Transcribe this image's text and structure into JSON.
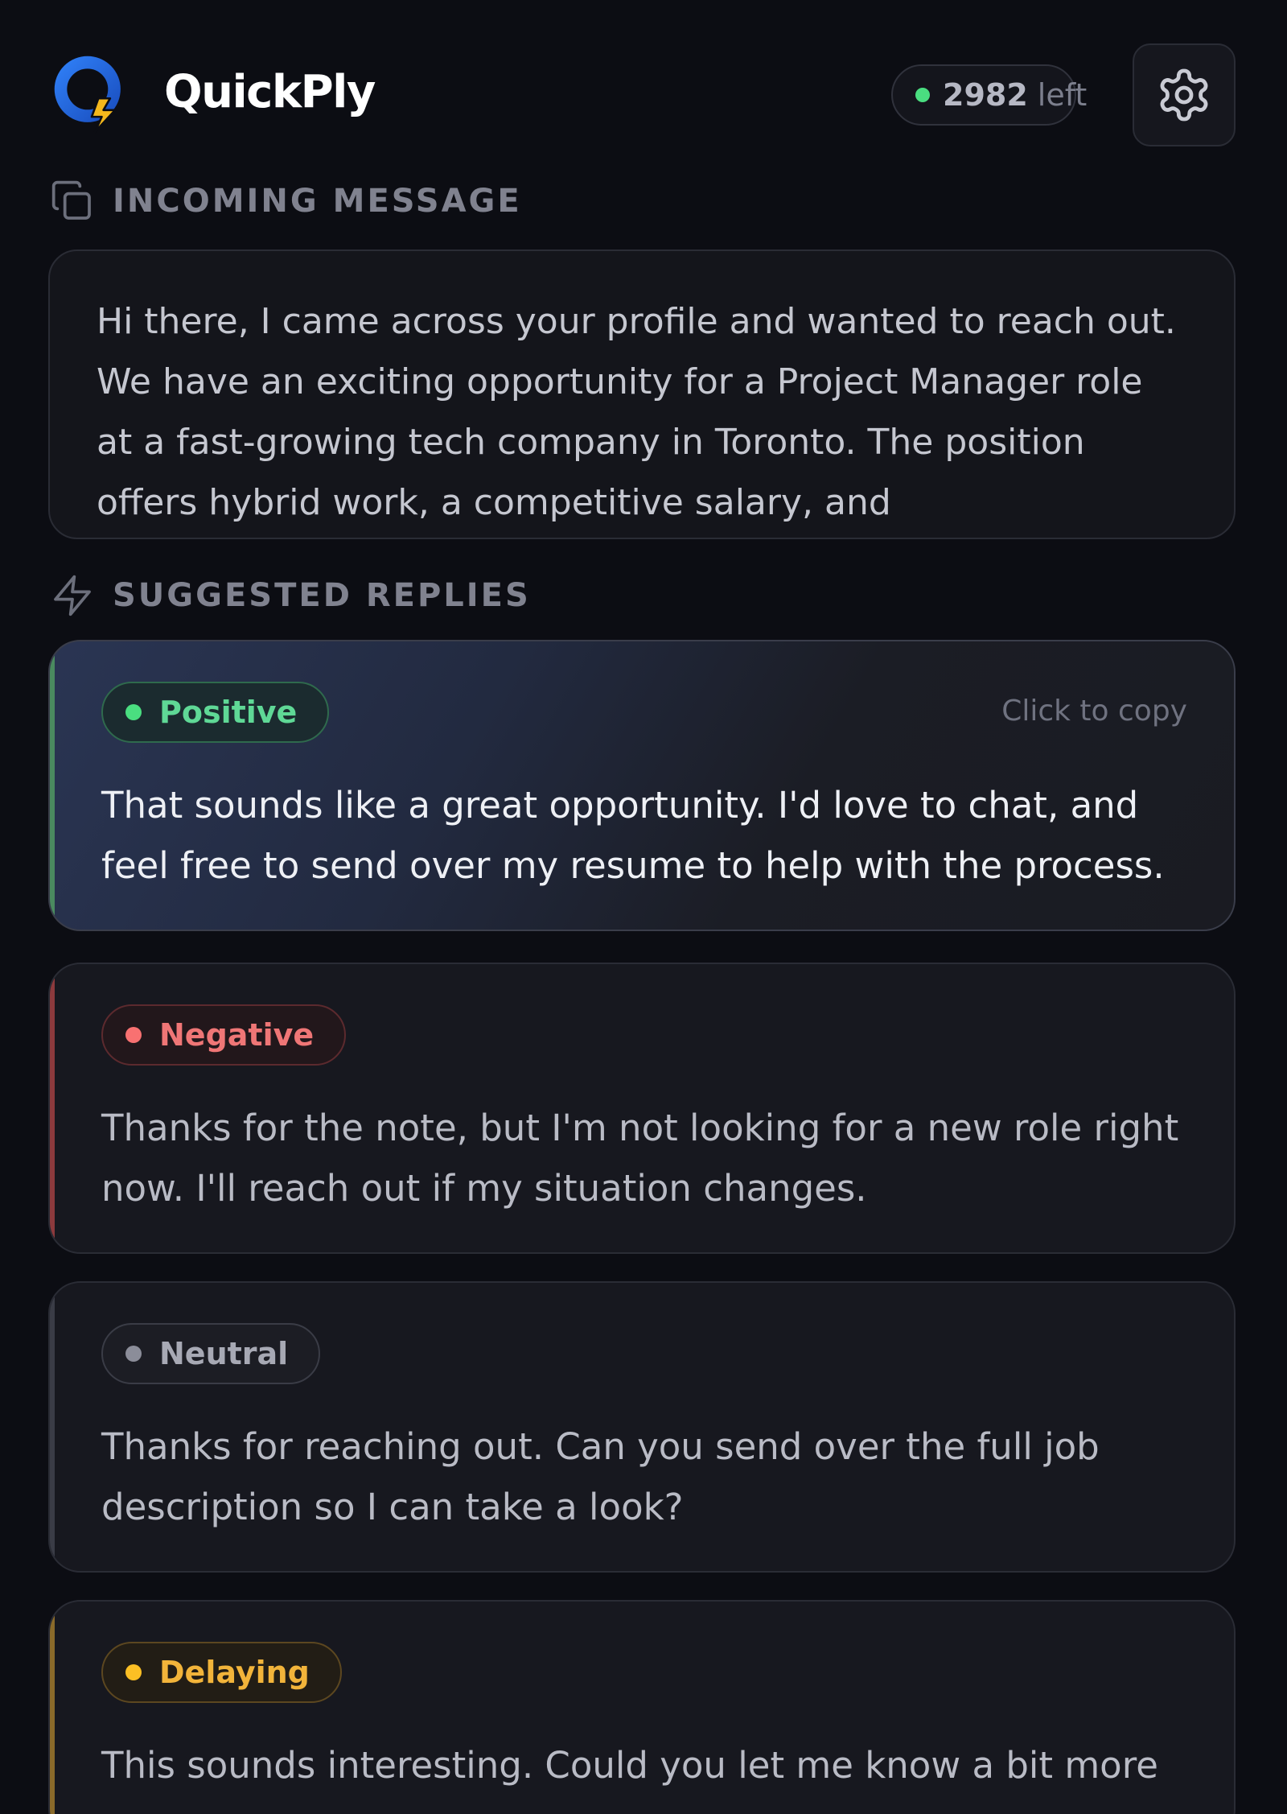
{
  "header": {
    "app_name": "QuickPly",
    "credits_count": "2982",
    "credits_suffix": "left"
  },
  "incoming": {
    "section_label": "INCOMING MESSAGE",
    "message": "Hi there, I came across your profile and wanted to reach out. We have an exciting opportunity for a Project Manager role at a fast-growing tech company in Toronto. The position offers hybrid work, a competitive salary, and"
  },
  "suggestions": {
    "section_label": "SUGGESTED REPLIES",
    "copy_hint": "Click to copy",
    "items": [
      {
        "tone": "Positive",
        "color": "#4ade80",
        "text": "That sounds like a great opportunity. I'd love to chat, and feel free to send over my resume to help with the process."
      },
      {
        "tone": "Negative",
        "color": "#f87171",
        "text": "Thanks for the note, but I'm not looking for a new role right now. I'll reach out if my situation changes."
      },
      {
        "tone": "Neutral",
        "color": "#8b8d99",
        "text": "Thanks for reaching out. Can you send over the full job description so I can take a look?"
      },
      {
        "tone": "Delaying",
        "color": "#fbbf24",
        "text": "This sounds interesting. Could you let me know a bit more"
      }
    ]
  }
}
